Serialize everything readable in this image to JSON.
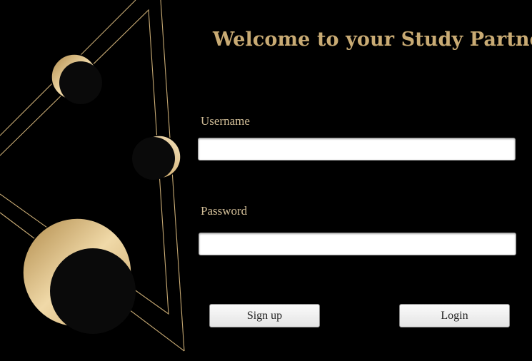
{
  "window": {
    "title": "Welcome to your Study Partner"
  },
  "form": {
    "username_label": "Username",
    "username_value": "",
    "password_label": "Password",
    "password_value": ""
  },
  "buttons": {
    "signup_label": "Sign up",
    "login_label": "Login"
  },
  "theme": {
    "background": "#000000",
    "accent_gold": "#c9ab74",
    "label_color": "#d3bf98"
  },
  "decoration": {
    "icons": [
      "crescent-moon-icon",
      "crescent-moon-icon",
      "crescent-moon-icon",
      "triangle-line-art"
    ]
  }
}
